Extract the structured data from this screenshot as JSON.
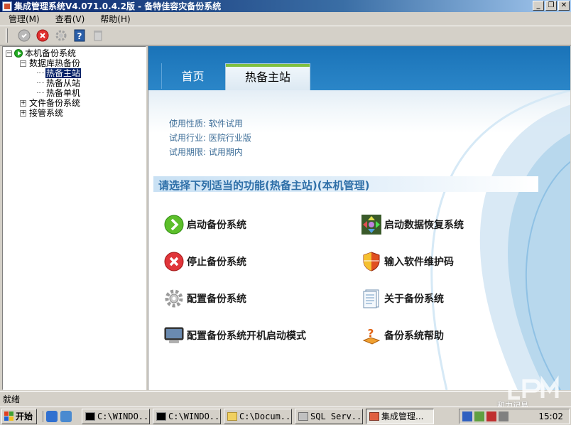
{
  "window": {
    "title": "集成管理系统V4.071.0.4.2版  - 备特佳容灾备份系统",
    "minimize_label": "_",
    "restore_label": "❐",
    "close_label": "✕"
  },
  "menu": {
    "items": [
      {
        "label": "管理(M)"
      },
      {
        "label": "查看(V)"
      },
      {
        "label": "帮助(H)"
      }
    ]
  },
  "toolbar": {
    "buttons": [
      {
        "icon": "start-gray-icon"
      },
      {
        "icon": "stop-red-icon"
      },
      {
        "icon": "gear-icon"
      },
      {
        "icon": "help-icon"
      },
      {
        "icon": "trash-icon"
      }
    ]
  },
  "tree": {
    "root": "本机备份系统",
    "db_backup": "数据库热备份",
    "hot_master": "热备主站",
    "hot_slave": "热备从站",
    "hot_single": "热备单机",
    "file_backup": "文件备份系统",
    "takeover": "接管系统",
    "expanded_symbol": "−",
    "collapsed_symbol": "+"
  },
  "tabs": {
    "home": "首页",
    "active": "热备主站"
  },
  "info": {
    "usage": "使用性质: 软件试用",
    "industry": "试用行业: 医院行业版",
    "period": "试用期限: 试用期内"
  },
  "function_title": "请选择下列适当的功能(热备主站)(本机管理)",
  "actions": {
    "start_backup": "启动备份系统",
    "stop_backup": "停止备份系统",
    "config_backup": "配置备份系统",
    "config_boot": "配置备份系统开机启动模式",
    "start_restore": "启动数据恢复系统",
    "enter_code": "输入软件维护码",
    "about": "关于备份系统",
    "help": "备份系统帮助"
  },
  "status": {
    "text": "就绪"
  },
  "taskbar": {
    "start": "开始",
    "tasks": [
      {
        "label": "C:\\WINDO..."
      },
      {
        "label": "C:\\WINDO..."
      },
      {
        "label": "C:\\Docum..."
      },
      {
        "label": "SQL Serv..."
      },
      {
        "label": "集成管理..."
      }
    ],
    "clock": "15:02"
  },
  "watermark": {
    "text": "和力记易"
  },
  "colors": {
    "title_bar": "#0a246a",
    "header_blue": "#1a73b8",
    "tab_accent": "#80c040",
    "info_text": "#3f6f99",
    "function_title": "#2e6fa8",
    "tree_selected": "#0a246a"
  }
}
